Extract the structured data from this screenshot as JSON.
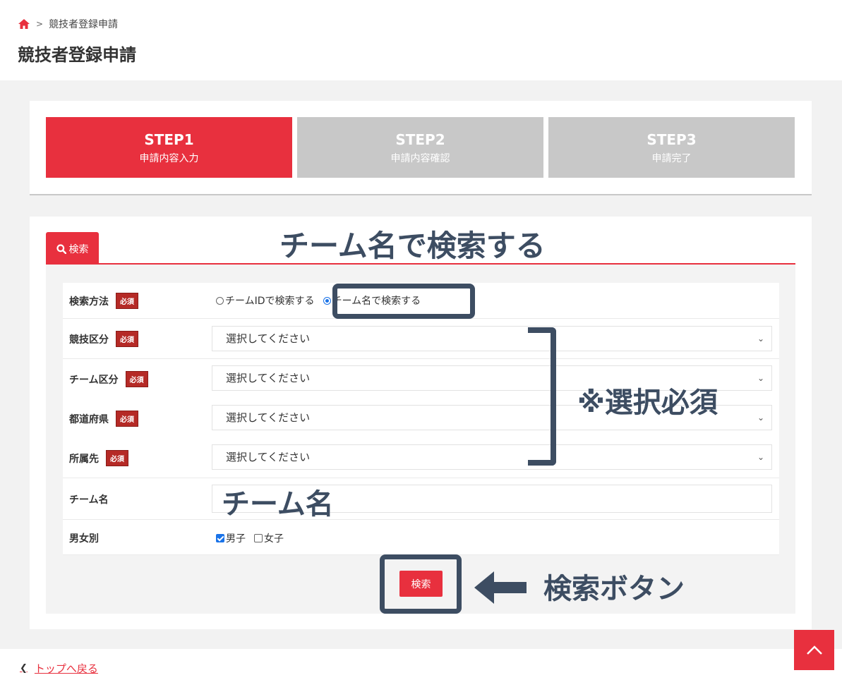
{
  "breadcrumb": {
    "home_icon": "home-icon",
    "separator": ">",
    "current": "競技者登録申請"
  },
  "page_title": "競技者登録申請",
  "steps": [
    {
      "title": "STEP1",
      "subtitle": "申請内容入力",
      "active": true
    },
    {
      "title": "STEP2",
      "subtitle": "申請内容確認",
      "active": false
    },
    {
      "title": "STEP3",
      "subtitle": "申請完了",
      "active": false
    }
  ],
  "search_tab": {
    "icon": "search-icon",
    "label": "検索"
  },
  "form": {
    "required_label": "必須",
    "search_method": {
      "label": "検索方法",
      "options": [
        "チームIDで検索する",
        "チーム名で検索する"
      ],
      "selected": "チーム名で検索する"
    },
    "sport_category": {
      "label": "競技区分",
      "value": "選択してください"
    },
    "team_category": {
      "label": "チーム区分",
      "value": "選択してください"
    },
    "prefecture": {
      "label": "都道府県",
      "value": "選択してください"
    },
    "affiliation": {
      "label": "所属先",
      "value": "選択してください"
    },
    "team_name": {
      "label": "チーム名",
      "value": ""
    },
    "gender": {
      "label": "男女別",
      "options": [
        {
          "label": "男子",
          "checked": true
        },
        {
          "label": "女子",
          "checked": false
        }
      ]
    },
    "submit_label": "検索"
  },
  "annotations": {
    "search_by_team_name": "チーム名で検索する",
    "selection_required": "※選択必須",
    "team_name": "チーム名",
    "search_button": "検索ボタン",
    "color": "#3d4d62"
  },
  "footer": {
    "back_link": "トップへ戻る"
  },
  "colors": {
    "accent": "#e8303e",
    "step_inactive": "#c8c8c8",
    "required_badge": "#b52a26"
  }
}
